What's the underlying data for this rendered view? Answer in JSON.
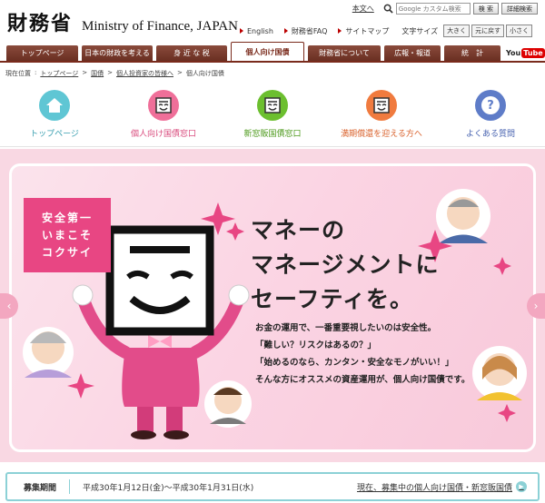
{
  "header": {
    "logo_jp": "財務省",
    "logo_en": "Ministry of Finance, JAPAN",
    "text_version": "本文へ",
    "search_placeholder": "Google カスタム検索",
    "search_button": "検 索",
    "advanced_search": "詳細検索",
    "links": [
      "English",
      "財務省FAQ",
      "サイトマップ"
    ],
    "font_size_label": "文字サイズ",
    "font_size_buttons": [
      "大きく",
      "元に戻す",
      "小さく"
    ]
  },
  "gnav": {
    "tabs": [
      {
        "label": "トップページ",
        "active": false
      },
      {
        "label": "日本の財政を考える",
        "active": false
      },
      {
        "label": "身 近 な 税",
        "active": false
      },
      {
        "label": "個人向け国債",
        "active": true
      },
      {
        "label": "財務省について",
        "active": false
      },
      {
        "label": "広報・報道",
        "active": false
      },
      {
        "label": "統　計",
        "active": false
      }
    ],
    "youtube_you": "You",
    "youtube_tube": "Tube"
  },
  "breadcrumb": {
    "label": "現在位置",
    "items": [
      "トップページ",
      "国債",
      "個人投資家の皆様へ",
      "個人向け国債"
    ]
  },
  "icon_nav": [
    {
      "label": "トップページ",
      "icon": "home-icon",
      "color": "#5fc6d4",
      "text_color": "#3a9fb0"
    },
    {
      "label": "個人向け国債窓口",
      "icon": "character-face-icon",
      "color": "#ef6f99",
      "text_color": "#d94c7e"
    },
    {
      "label": "新窓販国債窓口",
      "icon": "character-face-icon",
      "color": "#6cbf2f",
      "text_color": "#4d9a1c"
    },
    {
      "label": "満期償還を迎える方へ",
      "icon": "character-face-icon",
      "color": "#f07b3f",
      "text_color": "#d9602a"
    },
    {
      "label": "よくある質問",
      "icon": "question-icon",
      "color": "#5e7cc8",
      "text_color": "#4863b0"
    }
  ],
  "hero": {
    "badge_lines": [
      "安全第一",
      "いまこそ",
      "コクサイ"
    ],
    "headline_lines": [
      "マネーの",
      "マネージメントに",
      "セーフティを。"
    ],
    "body_lines": [
      "お金の運用で、一番重要視したいのは安全性。",
      "「難しい？リスクはあるの？」",
      "「始めるのなら、カンタン・安全なモノがいい！」",
      "そんな方にオススメの資産運用が、個人向け国債です。"
    ]
  },
  "period": {
    "label": "募集期間",
    "dates": "平成30年1月12日(金)〜平成30年1月31日(水)",
    "link": "現在、募集中の個人向け国債・新窓販国債"
  }
}
